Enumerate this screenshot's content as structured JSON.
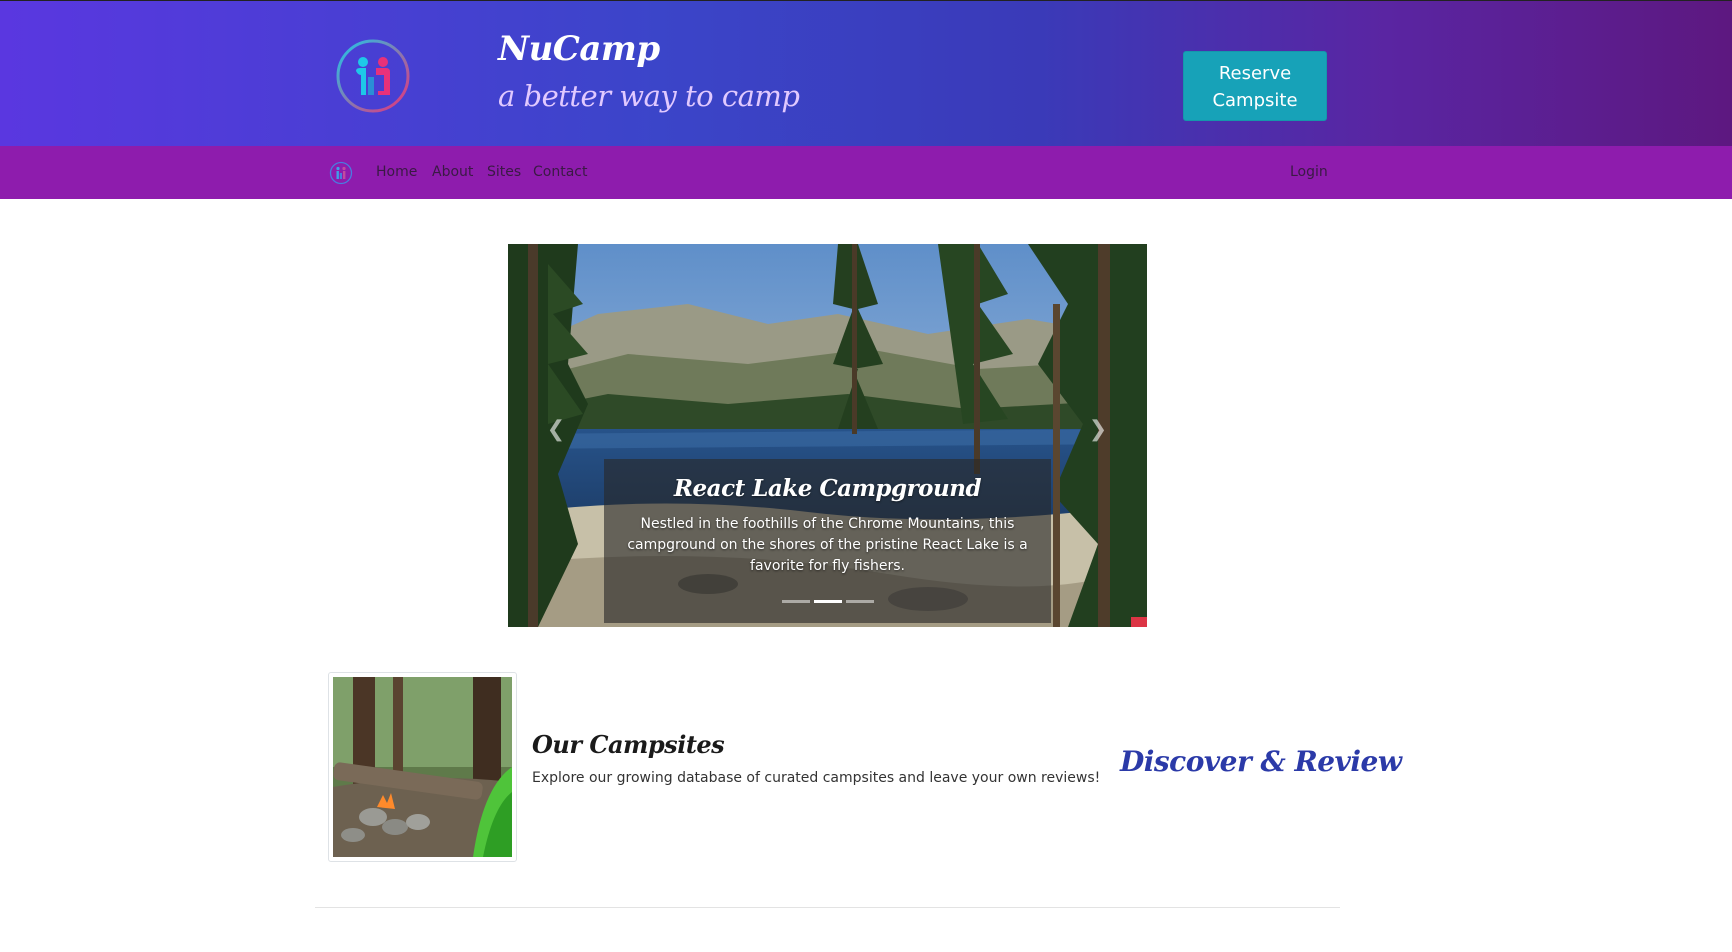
{
  "header": {
    "title": "NuCamp",
    "tagline": "a better way to camp",
    "reserve_button": [
      "Reserve",
      "Campsite"
    ]
  },
  "nav": {
    "items": [
      "Home",
      "About",
      "Sites",
      "Contact"
    ],
    "login": "Login"
  },
  "carousel": {
    "slide_count": 3,
    "active_index": 1,
    "caption_title": "React Lake Campground",
    "caption_text": "Nestled in the foothills of the Chrome Mountains, this campground on the shores of the pristine React Lake is a favorite for fly fishers."
  },
  "media": {
    "heading": "Our Campsites",
    "text": "Explore our growing database of curated campsites and leave your own reviews!",
    "tagline": "Discover & Review"
  },
  "icons": {
    "logo": "nucamp-logo-icon",
    "prev": "chevron-left-icon",
    "next": "chevron-right-icon"
  },
  "colors": {
    "header_start": "#5a37e0",
    "header_end": "#5d1880",
    "navbar": "#8e1cad",
    "reserve_button": "#17a2b8",
    "discover_text": "#2b3aa8"
  }
}
